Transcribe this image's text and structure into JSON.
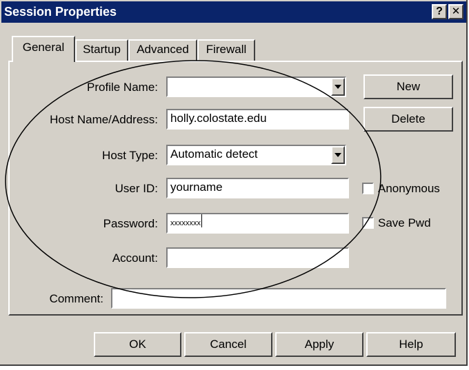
{
  "window": {
    "title": "Session Properties",
    "help_symbol": "?",
    "close_symbol": "✕"
  },
  "tabs": [
    {
      "label": "General",
      "active": true
    },
    {
      "label": "Startup",
      "active": false
    },
    {
      "label": "Advanced",
      "active": false
    },
    {
      "label": "Firewall",
      "active": false
    }
  ],
  "form": {
    "profile_name": {
      "label": "Profile Name:",
      "value": ""
    },
    "host_name": {
      "label": "Host Name/Address:",
      "value": "holly.colostate.edu"
    },
    "host_type": {
      "label": "Host Type:",
      "value": "Automatic detect"
    },
    "user_id": {
      "label": "User ID:",
      "value": "yourname"
    },
    "password": {
      "label": "Password:",
      "value": "xxxxxxxx"
    },
    "account": {
      "label": "Account:",
      "value": ""
    },
    "comment": {
      "label": "Comment:",
      "value": ""
    }
  },
  "side_buttons": {
    "new_label": "New",
    "delete_label": "Delete"
  },
  "checkboxes": {
    "anonymous": {
      "label": "Anonymous",
      "checked": false
    },
    "save_pwd": {
      "label": "Save Pwd",
      "checked": false
    }
  },
  "footer": {
    "ok_label": "OK",
    "cancel_label": "Cancel",
    "apply_label": "Apply",
    "help_label": "Help"
  },
  "colors": {
    "titlebar": "#0a246a",
    "face": "#d4d0c8",
    "field_bg": "#ffffff"
  }
}
